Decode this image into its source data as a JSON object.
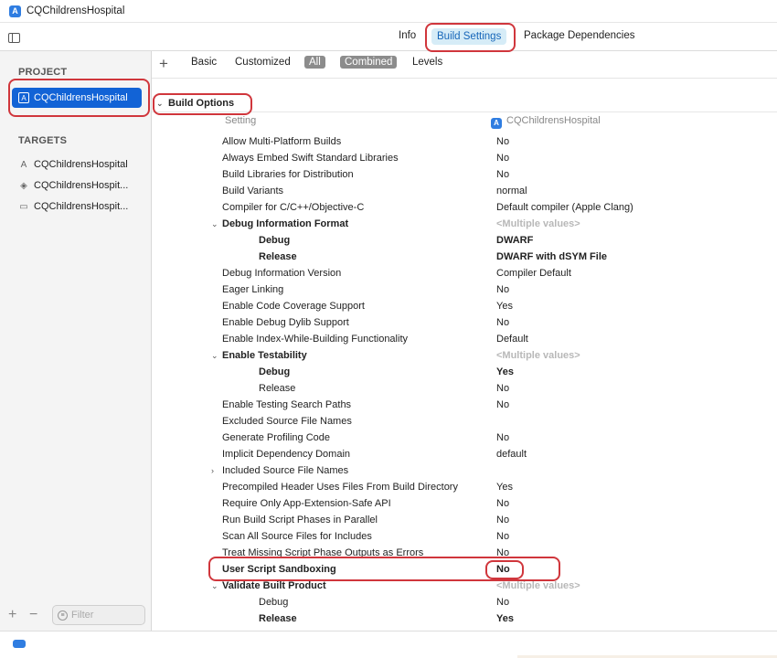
{
  "window": {
    "title": "CQChildrensHospital"
  },
  "tabs": {
    "info": "Info",
    "build_settings": "Build Settings",
    "package_dependencies": "Package Dependencies"
  },
  "sidebar": {
    "project_header": "PROJECT",
    "project": "CQChildrensHospital",
    "targets_header": "TARGETS",
    "targets": [
      "CQChildrensHospital",
      "CQChildrensHospit...",
      "CQChildrensHospit..."
    ],
    "filter_placeholder": "Filter"
  },
  "filterbar": {
    "basic": "Basic",
    "customized": "Customized",
    "all": "All",
    "combined": "Combined",
    "levels": "Levels"
  },
  "section": {
    "title": "Build Options",
    "col_setting": "Setting",
    "col_target": "CQChildrensHospital"
  },
  "rows": [
    {
      "name": "Allow Multi-Platform Builds",
      "value": "No"
    },
    {
      "name": "Always Embed Swift Standard Libraries",
      "value": "No"
    },
    {
      "name": "Build Libraries for Distribution",
      "value": "No"
    },
    {
      "name": "Build Variants",
      "value": "normal"
    },
    {
      "name": "Compiler for C/C++/Objective-C",
      "value": "Default compiler (Apple Clang)"
    },
    {
      "name": "Debug Information Format",
      "value": "<Multiple values>"
    },
    {
      "name": "Debug",
      "value": "DWARF"
    },
    {
      "name": "Release",
      "value": "DWARF with dSYM File"
    },
    {
      "name": "Debug Information Version",
      "value": "Compiler Default"
    },
    {
      "name": "Eager Linking",
      "value": "No"
    },
    {
      "name": "Enable Code Coverage Support",
      "value": "Yes"
    },
    {
      "name": "Enable Debug Dylib Support",
      "value": "No"
    },
    {
      "name": "Enable Index-While-Building Functionality",
      "value": "Default"
    },
    {
      "name": "Enable Testability",
      "value": "<Multiple values>"
    },
    {
      "name": "Debug",
      "value": "Yes"
    },
    {
      "name": "Release",
      "value": "No"
    },
    {
      "name": "Enable Testing Search Paths",
      "value": "No"
    },
    {
      "name": "Excluded Source File Names",
      "value": ""
    },
    {
      "name": "Generate Profiling Code",
      "value": "No"
    },
    {
      "name": "Implicit Dependency Domain",
      "value": "default"
    },
    {
      "name": "Included Source File Names",
      "value": ""
    },
    {
      "name": "Precompiled Header Uses Files From Build Directory",
      "value": "Yes"
    },
    {
      "name": "Require Only App-Extension-Safe API",
      "value": "No"
    },
    {
      "name": "Run Build Script Phases in Parallel",
      "value": "No"
    },
    {
      "name": "Scan All Source Files for Includes",
      "value": "No"
    },
    {
      "name": "Treat Missing Script Phase Outputs as Errors",
      "value": "No"
    },
    {
      "name": "User Script Sandboxing",
      "value": "No"
    },
    {
      "name": "Validate Built Product",
      "value": "<Multiple values>"
    },
    {
      "name": "Debug",
      "value": "No"
    },
    {
      "name": "Release",
      "value": "Yes"
    }
  ],
  "colors": {
    "accent": "#1263d6",
    "highlight": "#d0363c",
    "selected_tab_bg": "#d6ecf7"
  }
}
